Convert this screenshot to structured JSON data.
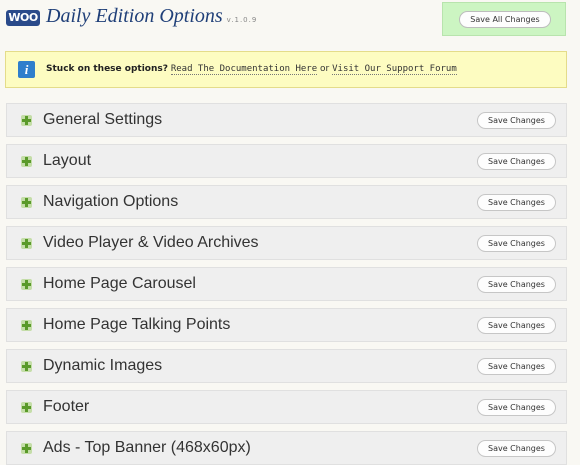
{
  "header": {
    "logo_text": "WOO",
    "title": "Daily Edition Options",
    "version": "v.1.0.9",
    "save_all_label": "Save All Changes"
  },
  "notice": {
    "icon": "info-icon",
    "lead": "Stuck on these options?",
    "link_docs": "Read The Documentation Here",
    "separator": "or",
    "link_support": "Visit Our Support Forum"
  },
  "sections": [
    {
      "title": "General Settings",
      "save_label": "Save Changes",
      "icon": "plus-icon"
    },
    {
      "title": "Layout",
      "save_label": "Save Changes",
      "icon": "plus-icon"
    },
    {
      "title": "Navigation Options",
      "save_label": "Save Changes",
      "icon": "plus-icon"
    },
    {
      "title": "Video Player & Video Archives",
      "save_label": "Save Changes",
      "icon": "plus-icon"
    },
    {
      "title": "Home Page Carousel",
      "save_label": "Save Changes",
      "icon": "plus-icon"
    },
    {
      "title": "Home Page Talking Points",
      "save_label": "Save Changes",
      "icon": "plus-icon"
    },
    {
      "title": "Dynamic Images",
      "save_label": "Save Changes",
      "icon": "plus-icon"
    },
    {
      "title": "Footer",
      "save_label": "Save Changes",
      "icon": "plus-icon"
    },
    {
      "title": "Ads - Top Banner (468x60px)",
      "save_label": "Save Changes",
      "icon": "plus-icon"
    }
  ],
  "colors": {
    "title_blue": "#1f3f78",
    "save_all_bg": "#ccf5c2",
    "notice_bg": "#fdfcc1",
    "section_bg": "#efefef",
    "plus_green": "#5a9a2a"
  }
}
